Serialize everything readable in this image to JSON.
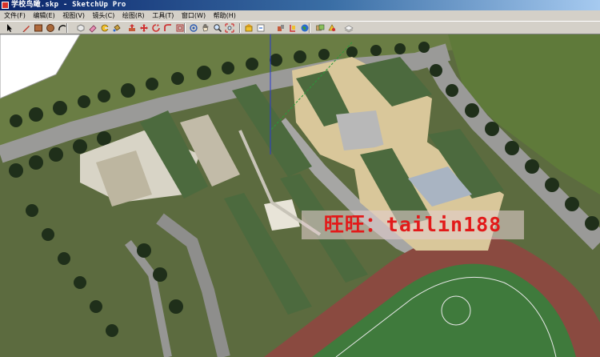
{
  "window": {
    "title": "学校鸟瞰.skp - SketchUp Pro"
  },
  "menu": {
    "items": [
      {
        "key": "file",
        "label": "文件(F)"
      },
      {
        "key": "edit",
        "label": "编辑(E)"
      },
      {
        "key": "view",
        "label": "视图(V)"
      },
      {
        "key": "camera",
        "label": "镜头(C)"
      },
      {
        "key": "draw",
        "label": "绘图(R)"
      },
      {
        "key": "tools",
        "label": "工具(T)"
      },
      {
        "key": "window",
        "label": "窗口(W)"
      },
      {
        "key": "help",
        "label": "帮助(H)"
      }
    ]
  },
  "toolbar": {
    "tools": [
      {
        "name": "select",
        "icon": "arrow-cursor-icon"
      },
      {
        "name": "line",
        "icon": "pencil-icon"
      },
      {
        "name": "rectangle",
        "icon": "rectangle-icon"
      },
      {
        "name": "circle",
        "icon": "circle-icon"
      },
      {
        "name": "arc",
        "icon": "arc-icon"
      },
      {
        "name": "make-component",
        "icon": "component-icon"
      },
      {
        "name": "eraser",
        "icon": "eraser-icon"
      },
      {
        "name": "tape-measure",
        "icon": "tape-measure-icon"
      },
      {
        "name": "paint-bucket",
        "icon": "paint-bucket-icon"
      },
      {
        "name": "push-pull",
        "icon": "push-pull-icon"
      },
      {
        "name": "move",
        "icon": "move-icon"
      },
      {
        "name": "rotate",
        "icon": "rotate-icon"
      },
      {
        "name": "follow-me",
        "icon": "follow-me-icon"
      },
      {
        "name": "offset",
        "icon": "offset-icon"
      },
      {
        "name": "orbit",
        "icon": "orbit-icon"
      },
      {
        "name": "pan",
        "icon": "pan-hand-icon"
      },
      {
        "name": "zoom",
        "icon": "zoom-icon"
      },
      {
        "name": "zoom-extents",
        "icon": "zoom-extents-icon"
      },
      {
        "name": "3d-warehouse",
        "icon": "warehouse-icon"
      },
      {
        "name": "share-model",
        "icon": "share-model-icon"
      },
      {
        "name": "components-window",
        "icon": "components-window-icon"
      },
      {
        "name": "extension-warehouse",
        "icon": "extension-icon"
      },
      {
        "name": "google-earth",
        "icon": "earth-icon"
      },
      {
        "name": "styles",
        "icon": "styles-icon"
      },
      {
        "name": "materials",
        "icon": "materials-icon"
      },
      {
        "name": "layers",
        "icon": "layers-icon"
      }
    ]
  },
  "watermark": {
    "text": "旺旺：tailin188"
  },
  "colors": {
    "title_start": "#0a246a",
    "title_end": "#a6caf0",
    "ui_face": "#d4d0c8",
    "grass": "#5c6b3f",
    "road": "#9a9a98",
    "roof": "#4c6a3e",
    "track": "#8a4a40",
    "field": "#3f7a3c",
    "watermark_text": "#e21a1a"
  }
}
